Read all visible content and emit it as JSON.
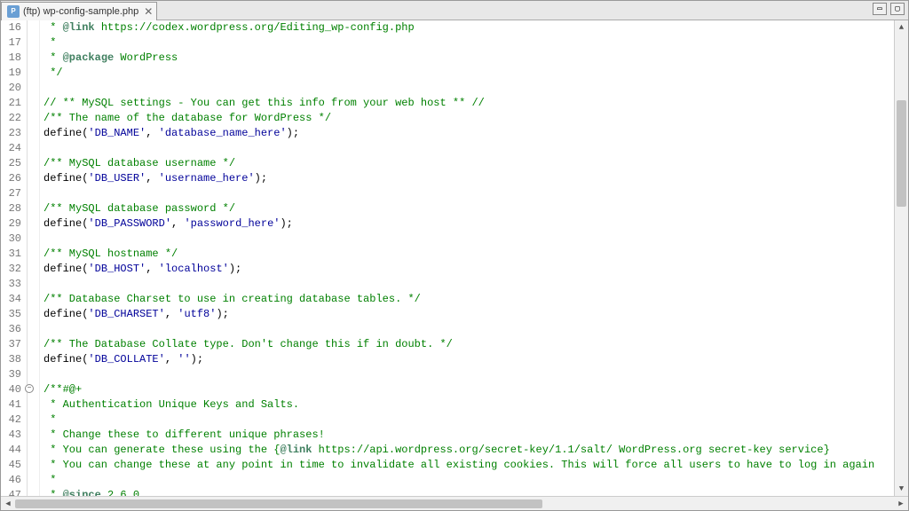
{
  "tab": {
    "title": "(ftp) wp-config-sample.php",
    "file_icon_label": "php"
  },
  "window": {
    "min": "▭",
    "max": "▢"
  },
  "gutter": {
    "start": 16,
    "end": 47,
    "fold_at": 40
  },
  "code": {
    "lines": [
      {
        "n": 16,
        "segs": [
          {
            "c": "c-comment",
            "t": " * "
          },
          {
            "c": "c-tag",
            "t": "@link"
          },
          {
            "c": "c-comment",
            "t": " https://codex.wordpress.org/Editing_wp-config.php"
          }
        ]
      },
      {
        "n": 17,
        "segs": [
          {
            "c": "c-comment",
            "t": " *"
          }
        ]
      },
      {
        "n": 18,
        "segs": [
          {
            "c": "c-comment",
            "t": " * "
          },
          {
            "c": "c-tag",
            "t": "@package"
          },
          {
            "c": "c-comment",
            "t": " WordPress"
          }
        ]
      },
      {
        "n": 19,
        "segs": [
          {
            "c": "c-comment",
            "t": " */"
          }
        ]
      },
      {
        "n": 20,
        "segs": []
      },
      {
        "n": 21,
        "segs": [
          {
            "c": "c-comment",
            "t": "// ** MySQL settings - You can get this info from your web host ** //"
          }
        ]
      },
      {
        "n": 22,
        "segs": [
          {
            "c": "c-comment",
            "t": "/** The name of the database for WordPress */"
          }
        ]
      },
      {
        "n": 23,
        "segs": [
          {
            "c": "",
            "t": "define("
          },
          {
            "c": "c-string",
            "t": "'DB_NAME'"
          },
          {
            "c": "",
            "t": ", "
          },
          {
            "c": "c-string",
            "t": "'database_name_here'"
          },
          {
            "c": "",
            "t": ");"
          }
        ]
      },
      {
        "n": 24,
        "segs": []
      },
      {
        "n": 25,
        "segs": [
          {
            "c": "c-comment",
            "t": "/** MySQL database username */"
          }
        ]
      },
      {
        "n": 26,
        "segs": [
          {
            "c": "",
            "t": "define("
          },
          {
            "c": "c-string",
            "t": "'DB_USER'"
          },
          {
            "c": "",
            "t": ", "
          },
          {
            "c": "c-string",
            "t": "'username_here'"
          },
          {
            "c": "",
            "t": ");"
          }
        ]
      },
      {
        "n": 27,
        "segs": []
      },
      {
        "n": 28,
        "segs": [
          {
            "c": "c-comment",
            "t": "/** MySQL database password */"
          }
        ]
      },
      {
        "n": 29,
        "segs": [
          {
            "c": "",
            "t": "define("
          },
          {
            "c": "c-string",
            "t": "'DB_PASSWORD'"
          },
          {
            "c": "",
            "t": ", "
          },
          {
            "c": "c-string",
            "t": "'password_here'"
          },
          {
            "c": "",
            "t": ");"
          }
        ]
      },
      {
        "n": 30,
        "segs": []
      },
      {
        "n": 31,
        "segs": [
          {
            "c": "c-comment",
            "t": "/** MySQL hostname */"
          }
        ]
      },
      {
        "n": 32,
        "segs": [
          {
            "c": "",
            "t": "define("
          },
          {
            "c": "c-string",
            "t": "'DB_HOST'"
          },
          {
            "c": "",
            "t": ", "
          },
          {
            "c": "c-string",
            "t": "'localhost'"
          },
          {
            "c": "",
            "t": ");"
          }
        ]
      },
      {
        "n": 33,
        "segs": []
      },
      {
        "n": 34,
        "segs": [
          {
            "c": "c-comment",
            "t": "/** Database Charset to use in creating database tables. */"
          }
        ]
      },
      {
        "n": 35,
        "segs": [
          {
            "c": "",
            "t": "define("
          },
          {
            "c": "c-string",
            "t": "'DB_CHARSET'"
          },
          {
            "c": "",
            "t": ", "
          },
          {
            "c": "c-string",
            "t": "'utf8'"
          },
          {
            "c": "",
            "t": ");"
          }
        ]
      },
      {
        "n": 36,
        "segs": []
      },
      {
        "n": 37,
        "segs": [
          {
            "c": "c-comment",
            "t": "/** The Database Collate type. Don't change this if in doubt. */"
          }
        ]
      },
      {
        "n": 38,
        "segs": [
          {
            "c": "",
            "t": "define("
          },
          {
            "c": "c-string",
            "t": "'DB_COLLATE'"
          },
          {
            "c": "",
            "t": ", "
          },
          {
            "c": "c-string",
            "t": "''"
          },
          {
            "c": "",
            "t": ");"
          }
        ]
      },
      {
        "n": 39,
        "segs": []
      },
      {
        "n": 40,
        "segs": [
          {
            "c": "c-comment",
            "t": "/**#@+"
          }
        ]
      },
      {
        "n": 41,
        "segs": [
          {
            "c": "c-comment",
            "t": " * Authentication Unique Keys and Salts."
          }
        ]
      },
      {
        "n": 42,
        "segs": [
          {
            "c": "c-comment",
            "t": " *"
          }
        ]
      },
      {
        "n": 43,
        "segs": [
          {
            "c": "c-comment",
            "t": " * Change these to different unique phrases!"
          }
        ]
      },
      {
        "n": 44,
        "segs": [
          {
            "c": "c-comment",
            "t": " * You can generate these using the {"
          },
          {
            "c": "c-tag",
            "t": "@link"
          },
          {
            "c": "c-comment",
            "t": " https://api.wordpress.org/secret-key/1.1/salt/ WordPress.org secret-key service}"
          }
        ]
      },
      {
        "n": 45,
        "segs": [
          {
            "c": "c-comment",
            "t": " * You can change these at any point in time to invalidate all existing cookies. This will force all users to have to log in again"
          }
        ]
      },
      {
        "n": 46,
        "segs": [
          {
            "c": "c-comment",
            "t": " *"
          }
        ]
      },
      {
        "n": 47,
        "segs": [
          {
            "c": "c-comment",
            "t": " * "
          },
          {
            "c": "c-tag",
            "t": "@since"
          },
          {
            "c": "c-comment",
            "t": " 2.6.0"
          }
        ]
      }
    ]
  }
}
